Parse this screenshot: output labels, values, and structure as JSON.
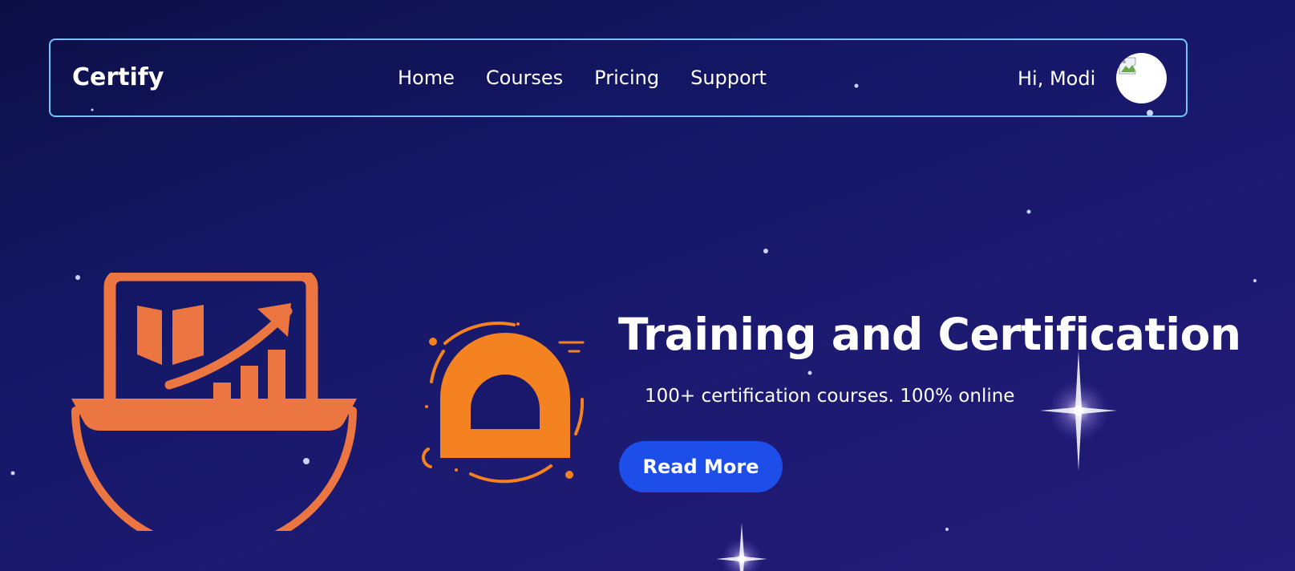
{
  "navbar": {
    "brand": "Certify",
    "links": [
      {
        "label": "Home"
      },
      {
        "label": "Courses"
      },
      {
        "label": "Pricing"
      },
      {
        "label": "Support"
      }
    ],
    "greeting": "Hi, Modi",
    "avatar_icon": "broken-image-icon"
  },
  "hero": {
    "title": "Training and Certification",
    "subtitle": "100+ certification courses. 100% online",
    "cta_label": "Read More",
    "illustrations": [
      "laptop-growth-chart-icon",
      "certificate-badge-icon"
    ]
  },
  "colors": {
    "background": "#141766",
    "navbar_border": "#73c4f7",
    "button": "#1d4eea",
    "illustration_coral": "#ec7641",
    "illustration_orange": "#f58220",
    "text": "#ffffff"
  }
}
